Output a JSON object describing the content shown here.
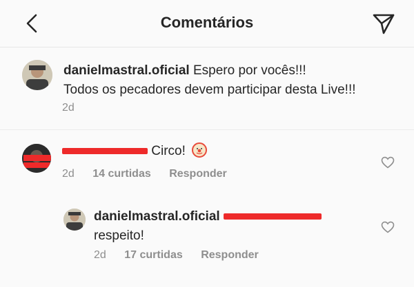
{
  "header": {
    "title": "Comentários"
  },
  "caption": {
    "username": "danielmastral.oficial",
    "text_line1": "Espero por vocês!!!",
    "text_line2": "Todos os pecadores devem participar desta Live!!!",
    "time": "2d"
  },
  "comments": [
    {
      "text": "Circo!",
      "emoji": "clown-face-emoji",
      "time": "2d",
      "likes": "14 curtidas",
      "reply_label": "Responder"
    }
  ],
  "replies": [
    {
      "username": "danielmastral.oficial",
      "text": "respeito!",
      "time": "2d",
      "likes": "17 curtidas",
      "reply_label": "Responder"
    }
  ],
  "colors": {
    "text": "#262626",
    "secondary": "#8e8e8e",
    "redaction": "#ee2a2a"
  },
  "icons": [
    "back-arrow-icon",
    "paper-plane-icon",
    "heart-outline-icon"
  ]
}
